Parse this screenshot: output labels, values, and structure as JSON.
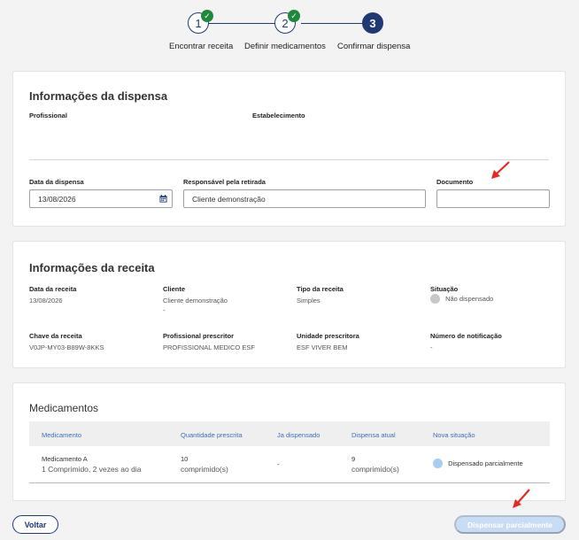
{
  "stepper": {
    "steps": [
      {
        "number": "1",
        "label": "Encontrar receita",
        "done": true
      },
      {
        "number": "2",
        "label": "Definir medicamentos",
        "done": true
      },
      {
        "number": "3",
        "label": "Confirmar dispensa",
        "done": false
      }
    ]
  },
  "dispensa": {
    "title": "Informações da dispensa",
    "profissional_label": "Profissional",
    "estabelecimento_label": "Estabelecimento",
    "data_label": "Data da dispensa",
    "data_value": "13/08/2026",
    "responsavel_label": "Responsável pela retirada",
    "responsavel_value": "Cliente demonstração",
    "documento_label": "Documento",
    "documento_value": ""
  },
  "receita": {
    "title": "Informações da receita",
    "fields": {
      "data_label": "Data da receita",
      "data_value": "13/08/2026",
      "cliente_label": "Cliente",
      "cliente_value": "Cliente demonstração",
      "cliente_extra": "-",
      "tipo_label": "Tipo da receita",
      "tipo_value": "Simples",
      "situacao_label": "Situação",
      "situacao_value": "Não dispensado",
      "chave_label": "Chave da receita",
      "chave_value": "V0JP-MY03-B89W-8KKS",
      "prescritor_label": "Profissional prescritor",
      "prescritor_value": "PROFISSIONAL MEDICO ESF",
      "unidade_label": "Unidade prescritora",
      "unidade_value": "ESF VIVER BEM",
      "notificacao_label": "Número de notificação",
      "notificacao_value": "-"
    }
  },
  "medicamentos": {
    "title": "Medicamentos",
    "headers": [
      "Medicamento",
      "Quantidade prescrita",
      "Ja dispensado",
      "Dispensa atual",
      "Nova situação"
    ],
    "rows": [
      {
        "nome": "Medicamento A",
        "posologia": "1 Comprimido, 2 vezes ao dia",
        "qtd_num": "10",
        "qtd_unit": "comprimido(s)",
        "ja_dispensado": "-",
        "atual_num": "9",
        "atual_unit": "comprimido(s)",
        "nova_situacao": "Dispensado parcialmente"
      }
    ]
  },
  "actions": {
    "voltar": "Voltar",
    "dispensar": "Dispensar parcialmente"
  },
  "colors": {
    "primary": "#1f3a72",
    "success": "#1d8a3b",
    "link": "#3d6fb6",
    "status_grey": "#c8c8c8",
    "status_partial": "#a8cdf3",
    "arrow": "#e8281e"
  }
}
